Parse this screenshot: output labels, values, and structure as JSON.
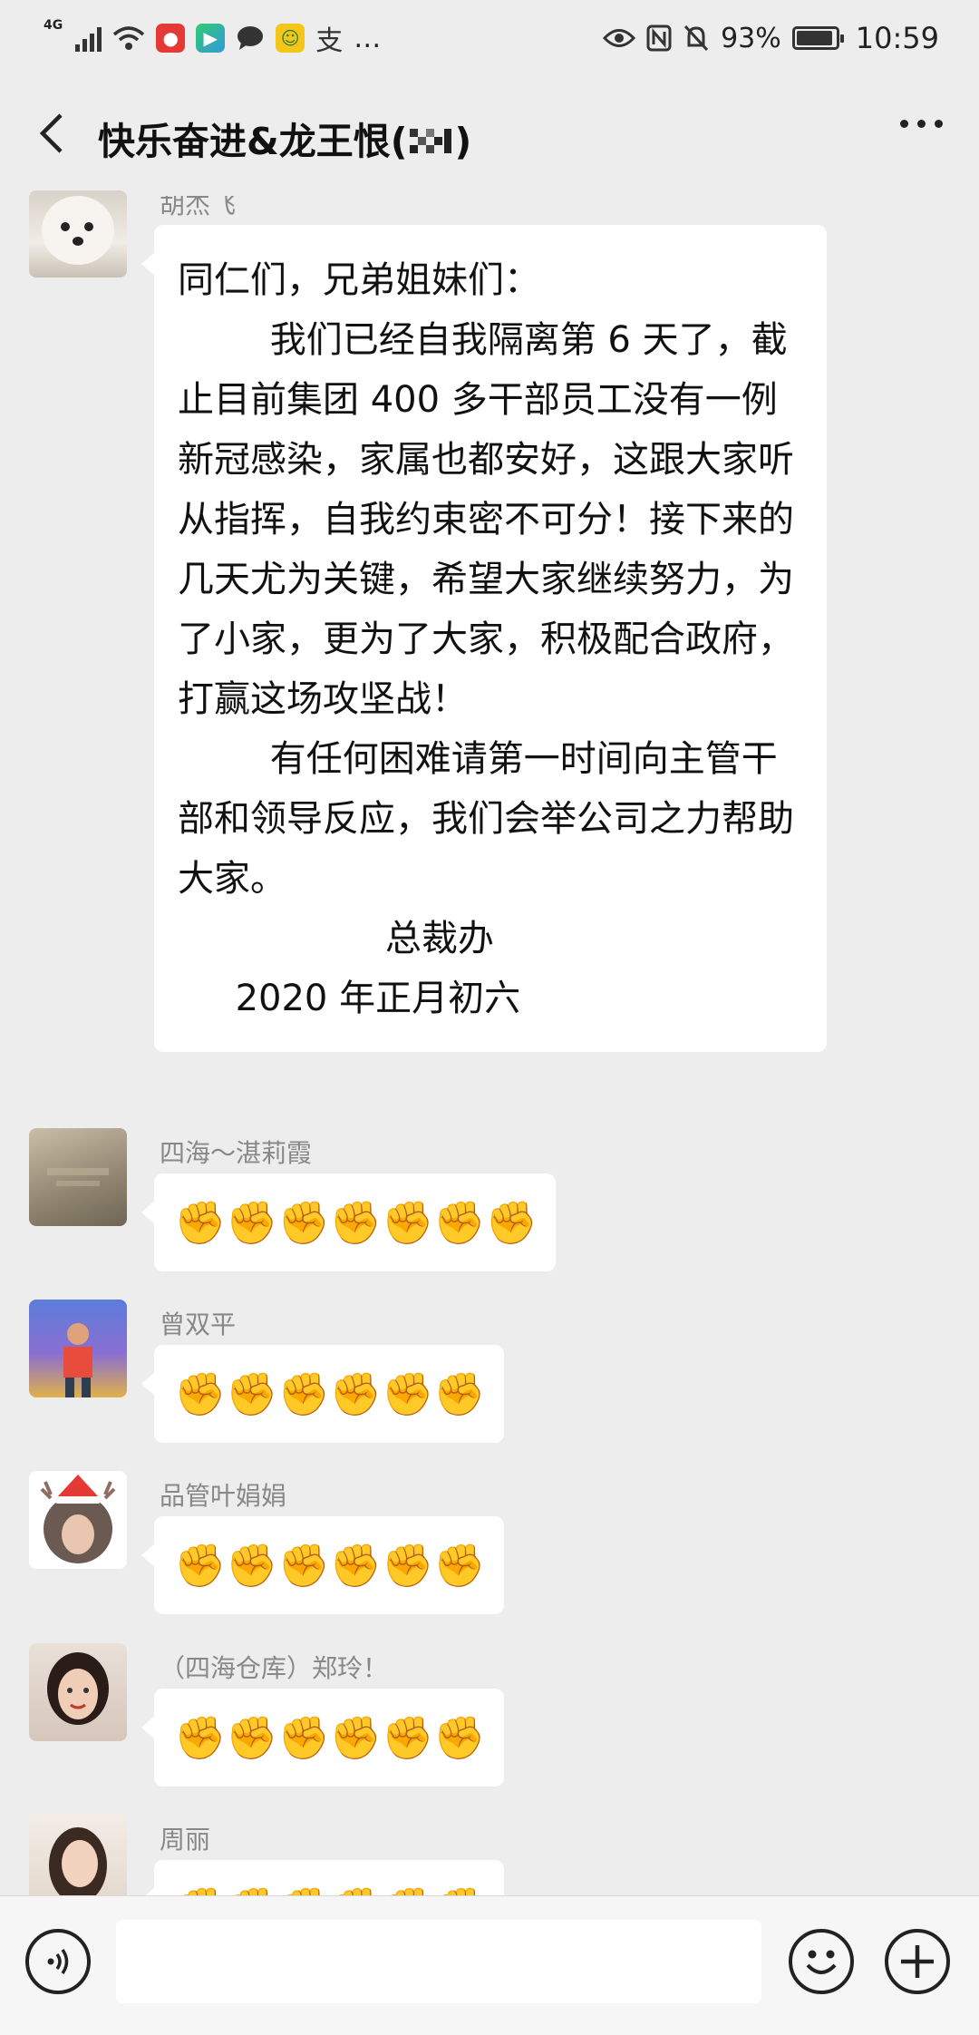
{
  "status_bar": {
    "network": "4G",
    "battery": "93%",
    "battery_level": 0.93,
    "time": "10:59",
    "overflow": "…"
  },
  "header": {
    "title": "快乐奋进&龙王恨(",
    "title_suffix": ")"
  },
  "messages": [
    {
      "sender": "胡杰飞",
      "text": "同仁们，兄弟姐妹们：\n        我们已经自我隔离第 6 天了，截止目前集团 400 多干部员工没有一例新冠感染，家属也都安好，这跟大家听从指挥，自我约束密不可分！接下来的几天尤为关键，希望大家继续努力，为了小家，更为了大家，积极配合政府，打赢这场攻坚战！\n        有任何困难请第一时间向主管干部和领导反应，我们会举公司之力帮助大家。\n                  总裁办\n     2020 年正月初六"
    },
    {
      "sender": "四海～湛莉霞",
      "content": "✊✊✊✊✊✊✊"
    },
    {
      "sender": "曾双平",
      "content": "✊✊✊✊✊✊"
    },
    {
      "sender": "品管叶娟娟",
      "content": "✊✊✊✊✊✊"
    },
    {
      "sender": "（四海仓库）郑玲！",
      "content": "✊✊✊✊✊✊"
    },
    {
      "sender": "周丽",
      "content": "✊✊✊✊✊✊"
    }
  ],
  "colors": {
    "background": "#ededed",
    "bubble": "#ffffff",
    "sender_name": "#888888"
  }
}
